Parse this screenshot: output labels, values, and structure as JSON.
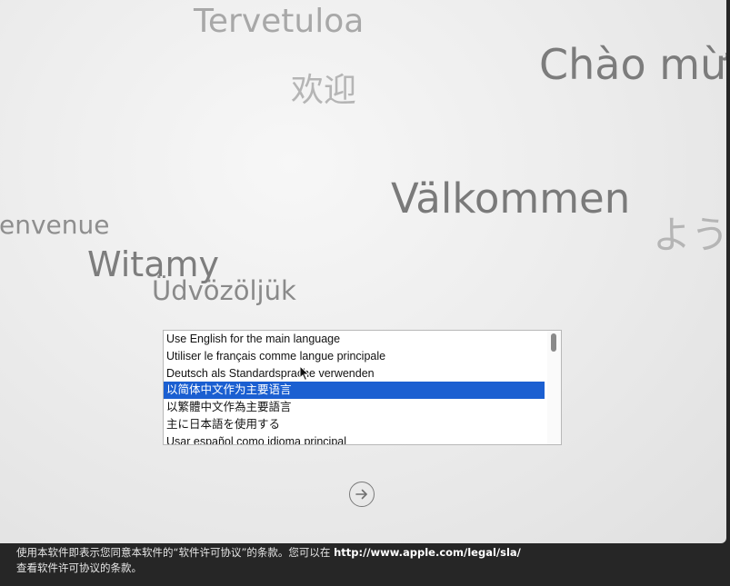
{
  "greetings": [
    "Tervetuloa",
    "Chào mừng",
    "欢迎",
    "Välkommen",
    "Bienvenue",
    "ようこそ",
    "Witamy",
    "Üdvözöljük"
  ],
  "language_list": {
    "items": [
      "Use English for the main language",
      "Utiliser le français comme langue principale",
      "Deutsch als Standardsprache verwenden",
      "以简体中文作为主要语言",
      "以繁體中文作為主要語言",
      "主に日本語を使用する",
      "Usar español como idioma principal"
    ],
    "selected_index": 3
  },
  "next_button": {
    "icon": "arrow-right-circle-icon"
  },
  "footer": {
    "line1_text": "使用本软件即表示您同意本软件的“软件许可协议”的条款。您可以在 ",
    "link": "http://www.apple.com/legal/sla/",
    "line2_text": "查看软件许可协议的条款。"
  },
  "colors": {
    "selection": "#1b5fd1",
    "background_dark": "#262626"
  }
}
